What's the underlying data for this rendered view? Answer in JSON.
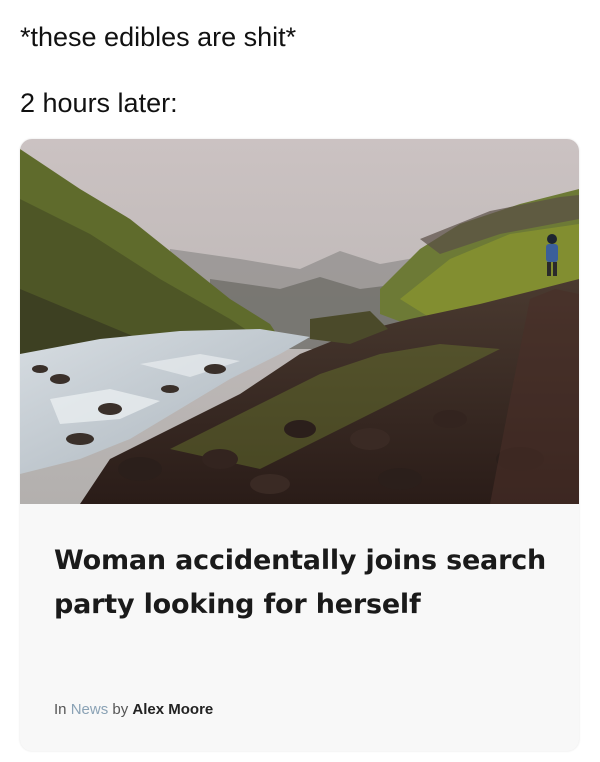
{
  "caption": {
    "line1": "*these edibles are shit*",
    "line2": "2 hours later:"
  },
  "article": {
    "headline": "Woman accidentally joins search party looking for herself",
    "byline_in": "In",
    "byline_category": "News",
    "byline_by": "by",
    "byline_author": "Alex Moore"
  },
  "colors": {
    "sky": "#c9c1c0",
    "grass": "#6b7a2c",
    "river": "#c9d0d6",
    "rock": "#3a2a24",
    "category_link": "#8aa2b5"
  }
}
